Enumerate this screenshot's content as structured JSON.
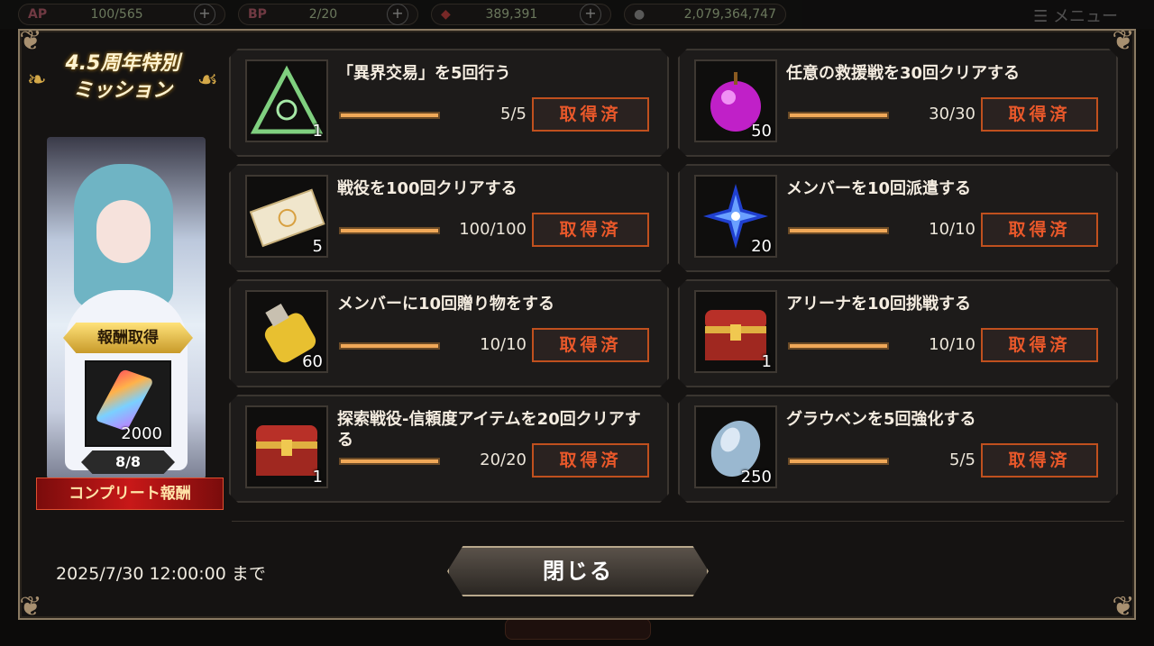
{
  "topbar": {
    "ap_label": "AP",
    "ap_value": "100/565",
    "bp_label": "BP",
    "bp_value": "2/20",
    "gems_value": "389,391",
    "coins_value": "2,079,364,747",
    "menu_label": "メニュー"
  },
  "event": {
    "title_line1": "4.5周年特別",
    "title_line2": "ミッション",
    "reward_button": "報酬取得",
    "reward_qty": "2000",
    "progress": "8/8",
    "complete_label": "コンプリート報酬",
    "deadline": "2025/7/30 12:00:00 まで",
    "close_label": "閉じる"
  },
  "missions": [
    {
      "title": "「異界交易」を5回行う",
      "progress": "5/5",
      "fill": 1.0,
      "qty": "1",
      "status": "取得済",
      "icon": "triangle-emblem-icon"
    },
    {
      "title": "任意の救援戦を30回クリアする",
      "progress": "30/30",
      "fill": 1.0,
      "qty": "50",
      "status": "取得済",
      "icon": "purple-apple-icon"
    },
    {
      "title": "戦役を100回クリアする",
      "progress": "100/100",
      "fill": 1.0,
      "qty": "5",
      "status": "取得済",
      "icon": "ticket-icon"
    },
    {
      "title": "メンバーを10回派遣する",
      "progress": "10/10",
      "fill": 1.0,
      "qty": "20",
      "status": "取得済",
      "icon": "blue-flower-icon"
    },
    {
      "title": "メンバーに10回贈り物をする",
      "progress": "10/10",
      "fill": 1.0,
      "qty": "60",
      "status": "取得済",
      "icon": "potion-bottle-icon"
    },
    {
      "title": "アリーナを10回挑戦する",
      "progress": "10/10",
      "fill": 1.0,
      "qty": "1",
      "status": "取得済",
      "icon": "treasure-chest-icon"
    },
    {
      "title": "探索戦役-信頼度アイテムを20回クリアする",
      "progress": "20/20",
      "fill": 1.0,
      "qty": "1",
      "status": "取得済",
      "icon": "treasure-chest-icon"
    },
    {
      "title": "グラウベンを5回強化する",
      "progress": "5/5",
      "fill": 1.0,
      "qty": "250",
      "status": "取得済",
      "icon": "crystal-gem-icon"
    }
  ],
  "colors": {
    "accent": "#e9582a",
    "bar": "#f0a858",
    "frame": "#8a7a62"
  }
}
